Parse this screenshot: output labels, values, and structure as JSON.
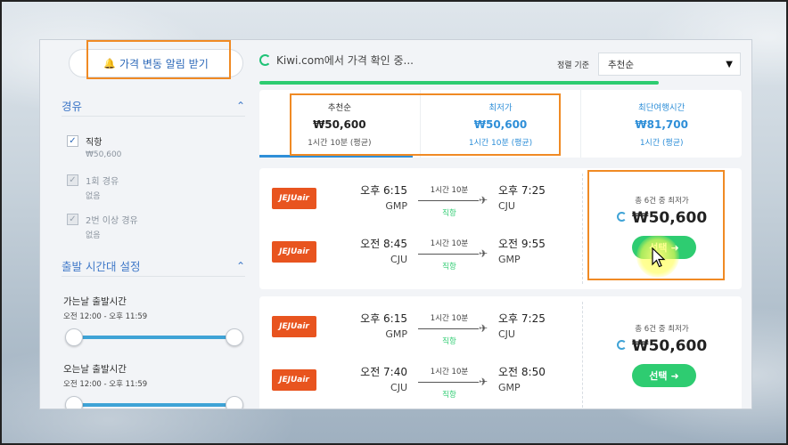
{
  "sidebar": {
    "alert_button": "가격 변동 알림 받기",
    "stops_section": {
      "title": "경유",
      "items": [
        {
          "label": "직항",
          "sub": "₩50,600"
        },
        {
          "label": "1회 경유",
          "sub": "없음"
        },
        {
          "label": "2번 이상 경유",
          "sub": "없음"
        }
      ]
    },
    "time_section": {
      "title": "출발 시간대 설정",
      "outbound_title": "가는날 출발시간",
      "outbound_range": "오전 12:00 - 오후 11:59",
      "return_title": "오는날 출발시간",
      "return_range": "오전 12:00 - 오후 11:59"
    }
  },
  "header": {
    "loading_text": "Kiwi.com에서 가격 확인 중...",
    "sort_label": "정렬 기준",
    "sort_value": "추천순"
  },
  "tabs": [
    {
      "label": "추천순",
      "price": "₩50,600",
      "duration": "1시간 10분 (평균)"
    },
    {
      "label": "최저가",
      "price": "₩50,600",
      "duration": "1시간 10분 (평균)"
    },
    {
      "label": "최단여행시간",
      "price": "₩81,700",
      "duration": "1시간 (평균)"
    }
  ],
  "results": [
    {
      "legs": [
        {
          "airline": "JEJUair",
          "dep_time": "오후 6:15",
          "dep_airport": "GMP",
          "duration": "1시간 10분",
          "stops": "직항",
          "arr_time": "오후 7:25",
          "arr_airport": "CJU"
        },
        {
          "airline": "JEJUair",
          "dep_time": "오전 8:45",
          "dep_airport": "CJU",
          "duration": "1시간 10분",
          "stops": "직항",
          "arr_time": "오전 9:55",
          "arr_airport": "GMP"
        }
      ],
      "cheapest_note": "총 6건 중 최저가",
      "price": "₩50,600",
      "select_label": "선택"
    },
    {
      "legs": [
        {
          "airline": "JEJUair",
          "dep_time": "오후 6:15",
          "dep_airport": "GMP",
          "duration": "1시간 10분",
          "stops": "직항",
          "arr_time": "오후 7:25",
          "arr_airport": "CJU"
        },
        {
          "airline": "JEJUair",
          "dep_time": "오전 7:40",
          "dep_airport": "CJU",
          "duration": "1시간 10분",
          "stops": "직항",
          "arr_time": "오전 8:50",
          "arr_airport": "GMP"
        }
      ],
      "cheapest_note": "총 6건 중 최저가",
      "price": "₩50,600",
      "select_label": "선택"
    }
  ],
  "colors": {
    "accent_blue": "#2f8fd8",
    "green": "#2ecc71",
    "highlight_orange": "#f08a24",
    "airline_red": "#e8541f"
  },
  "icons": {
    "bell": "bell-icon",
    "chevron_up": "chevron-up-icon",
    "dropdown": "caret-down-icon",
    "plane": "plane-icon",
    "arrow_right": "arrow-right-icon",
    "spinner": "spinner-icon"
  }
}
